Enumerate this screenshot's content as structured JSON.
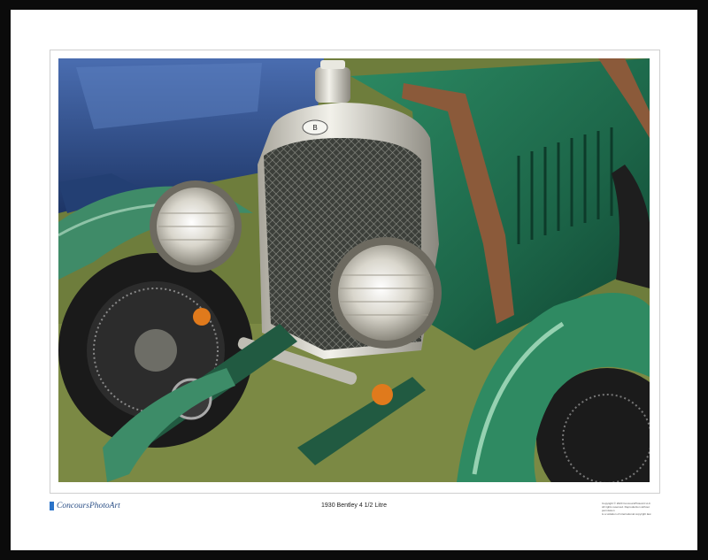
{
  "brand": {
    "name": "ConcoursPhotoArt"
  },
  "print": {
    "title": "1930 Bentley 4 1/2 Litre"
  },
  "fineprint": {
    "lines": [
      "Copyright © 2020 ConcoursPhotoArt LLC",
      "All rights reserved. Reproduction without permission",
      "is a violation of international copyright law."
    ]
  },
  "colors": {
    "frame": "#0b0b0b",
    "mat": "#ffffff",
    "car_green": "#1f6b4c",
    "grass": "#6b7a3a",
    "chrome": "#d8d8d0",
    "blue_car": "#2e4f8c",
    "brand_blue": "#2a73c9"
  },
  "photo": {
    "subject": "Front of a green vintage racing car with large chrome headlamps and mesh grille"
  }
}
